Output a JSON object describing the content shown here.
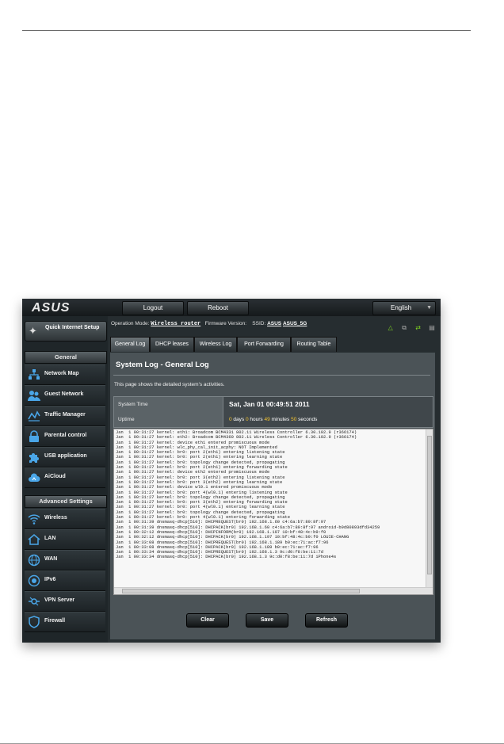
{
  "topbar": {
    "logo": "ASUS",
    "logout_label": "Logout",
    "reboot_label": "Reboot",
    "language": "English"
  },
  "sidebar": {
    "quick_setup": "Quick Internet Setup",
    "general_header": "General",
    "general_items": [
      {
        "label": "Network Map",
        "icon": "network-map-icon"
      },
      {
        "label": "Guest Network",
        "icon": "guest-network-icon"
      },
      {
        "label": "Traffic Manager",
        "icon": "traffic-manager-icon"
      },
      {
        "label": "Parental control",
        "icon": "lock-icon"
      },
      {
        "label": "USB application",
        "icon": "puzzle-icon"
      },
      {
        "label": "AiCloud",
        "icon": "cloud-icon"
      }
    ],
    "advanced_header": "Advanced Settings",
    "advanced_items": [
      {
        "label": "Wireless",
        "icon": "wifi-icon"
      },
      {
        "label": "LAN",
        "icon": "house-icon"
      },
      {
        "label": "WAN",
        "icon": "globe-icon"
      },
      {
        "label": "IPv6",
        "icon": "ipv6-icon"
      },
      {
        "label": "VPN Server",
        "icon": "vpn-icon"
      },
      {
        "label": "Firewall",
        "icon": "shield-icon"
      }
    ]
  },
  "status": {
    "op_mode_label": "Operation Mode:",
    "op_mode_value": "Wireless router",
    "firmware_label": "Firmware Version:",
    "ssid_label": "SSID:",
    "ssid_1": "ASUS",
    "ssid_2": "ASUS_5G"
  },
  "tabs": [
    {
      "label": "General Log",
      "active": true
    },
    {
      "label": "DHCP leases",
      "active": false
    },
    {
      "label": "Wireless Log",
      "active": false
    },
    {
      "label": "Port Forwarding",
      "active": false
    },
    {
      "label": "Routing Table",
      "active": false
    }
  ],
  "panel": {
    "title": "System Log - General Log",
    "description": "This page shows the detailed system's activities.",
    "system_time_label": "System Time",
    "system_time_value": "Sat, Jan 01  00:49:51  2011",
    "uptime_label": "Uptime",
    "uptime": {
      "days": "0",
      "days_unit": " days ",
      "hours": "0",
      "hours_unit": " hours ",
      "minutes": "49",
      "minutes_unit": " minutes ",
      "seconds": "50",
      "seconds_unit": " seconds"
    }
  },
  "log_lines": [
    "Jan  1 00:31:27 kernel: eth1: Broadcom BCM4331 802.11 Wireless Controller 6.30.102.9 (r366174)",
    "Jan  1 00:31:27 kernel: eth2: Broadcom BCM4360 802.11 Wireless Controller 6.30.102.9 (r366174)",
    "Jan  1 00:31:27 kernel: device eth1 entered promiscuous mode",
    "Jan  1 00:31:27 kernel: wlc_phy_cal_init_acphy: NOT Implemented",
    "Jan  1 00:31:27 kernel: br0: port 2(eth1) entering listening state",
    "Jan  1 00:31:27 kernel: br0: port 2(eth1) entering learning state",
    "Jan  1 00:31:27 kernel: br0: topology change detected, propagating",
    "Jan  1 00:31:27 kernel: br0: port 2(eth1) entering forwarding state",
    "Jan  1 00:31:27 kernel: device eth2 entered promiscuous mode",
    "Jan  1 00:31:27 kernel: br0: port 3(eth2) entering listening state",
    "Jan  1 00:31:27 kernel: br0: port 3(eth2) entering learning state",
    "Jan  1 00:31:27 kernel: device wl0.1 entered promiscuous mode",
    "Jan  1 00:31:27 kernel: br0: port 4(wl0.1) entering listening state",
    "Jan  1 00:31:27 kernel: br0: topology change detected, propagating",
    "Jan  1 00:31:27 kernel: br0: port 3(eth2) entering forwarding state",
    "Jan  1 00:31:27 kernel: br0: port 4(wl0.1) entering learning state",
    "Jan  1 00:31:27 kernel: br0: topology change detected, propagating",
    "Jan  1 00:31:27 kernel: br0: port 4(wl0.1) entering forwarding state",
    "Jan  1 00:31:39 dnsmasq-dhcp[510]: DHCPREQUEST(br0) 192.168.1.60 c4:6a:b7:89:8f:97",
    "Jan  1 00:31:39 dnsmasq-dhcp[510]: DHCPACK(br0) 192.168.1.60 c4:6a:b7:89:8f:97 android-b9d80893dfd34259",
    "Jan  1 00:32:12 dnsmasq-dhcp[510]: DHCPINFORM(br0) 192.168.1.197 10:bf:48:4c:b9:f0",
    "Jan  1 00:32:12 dnsmasq-dhcp[510]: DHCPACK(br0) 192.168.1.197 10:bf:48:4c:b9:f0 LOUIE-CHANG",
    "Jan  1 00:33:08 dnsmasq-dhcp[510]: DHCPREQUEST(br0) 192.168.1.189 b0:ec:71:ac:f7:96",
    "Jan  1 00:33:08 dnsmasq-dhcp[510]: DHCPACK(br0) 192.168.1.189 b0:ec:71:ac:f7:96",
    "Jan  1 00:33:34 dnsmasq-dhcp[510]: DHCPREQUEST(br0) 192.168.1.3 9c:d0:f8:be:11:7d",
    "Jan  1 00:33:34 dnsmasq-dhcp[510]: DHCPACK(br0) 192.168.1.3 9c:d0:f8:be:11:7d iPhone4s"
  ],
  "buttons": {
    "clear": "Clear",
    "save": "Save",
    "refresh": "Refresh"
  },
  "colors": {
    "accent_yellow": "#f4c430",
    "status_green": "#7ed321",
    "panel_gray": "#4b5357"
  }
}
